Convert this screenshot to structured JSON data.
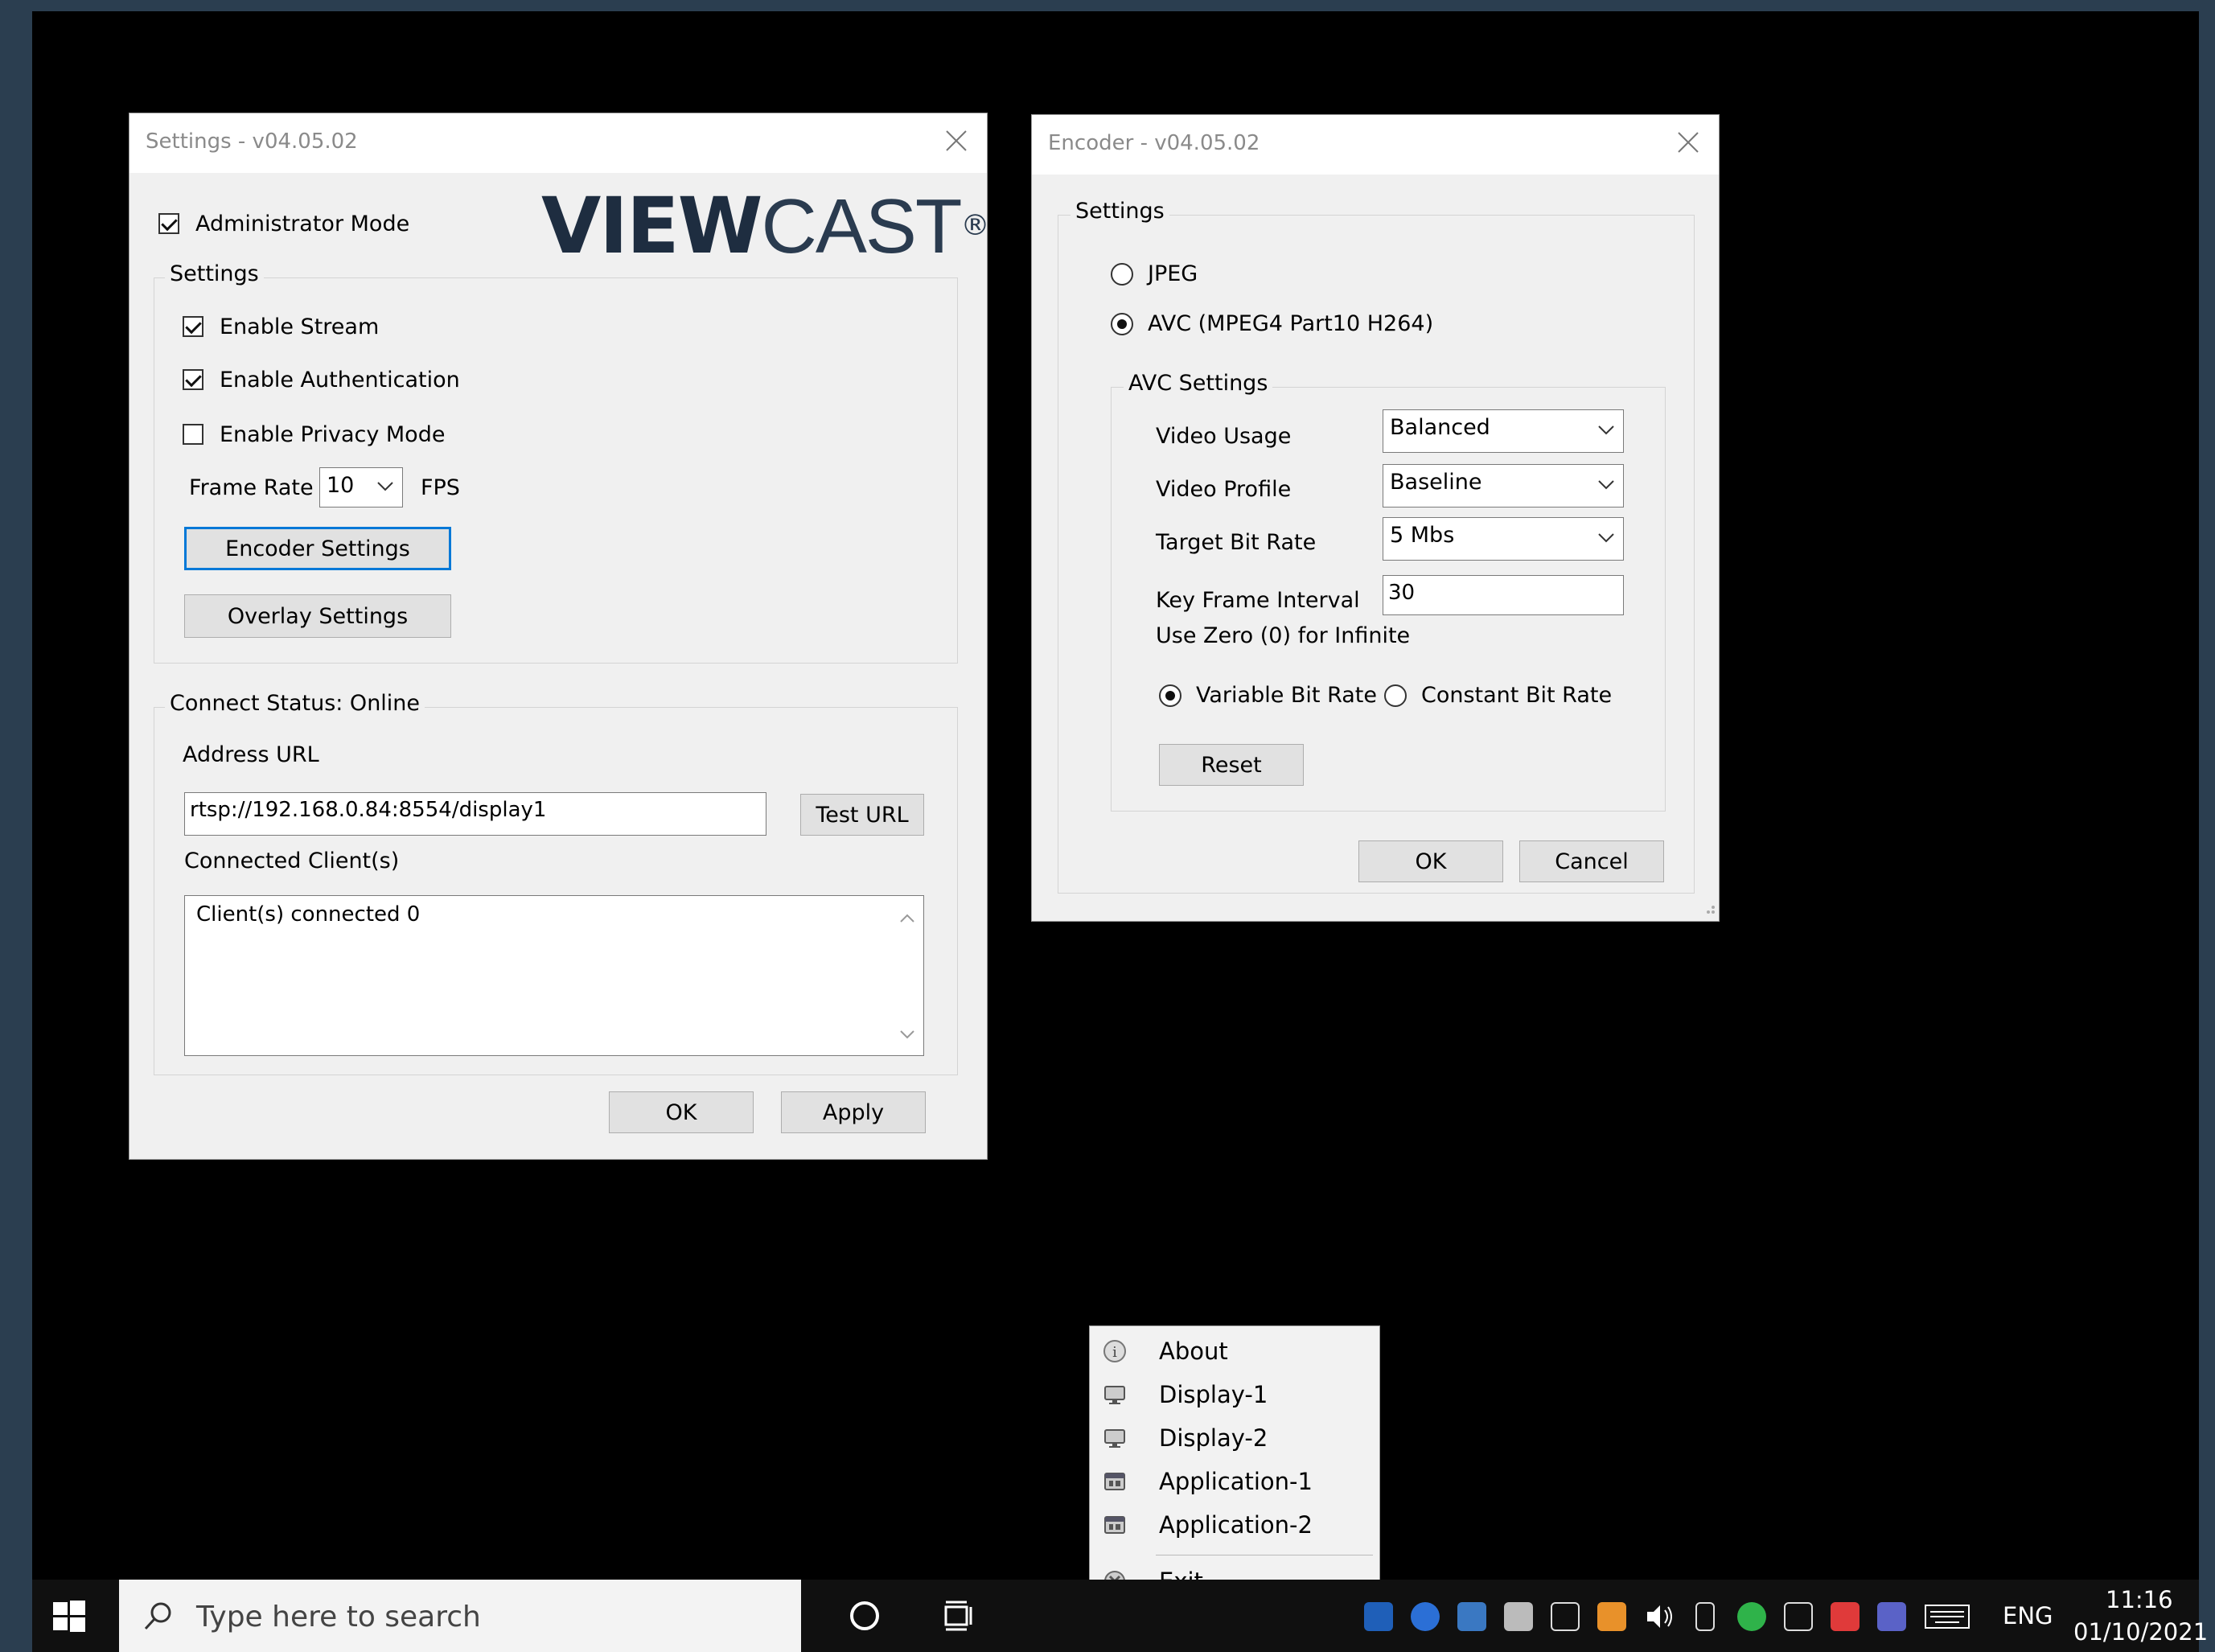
{
  "settings_window": {
    "title": "Settings - v04.05.02",
    "admin_mode_label": "Administrator Mode",
    "logo_bold": "VIEW",
    "logo_light": "CAST",
    "logo_mark": "®",
    "group_settings_label": "Settings",
    "enable_stream_label": "Enable Stream",
    "enable_auth_label": "Enable Authentication",
    "enable_privacy_label": "Enable Privacy Mode",
    "frame_rate_label": "Frame Rate",
    "frame_rate_value": "10",
    "fps_label": "FPS",
    "encoder_settings_label": "Encoder Settings",
    "overlay_settings_label": "Overlay Settings",
    "connect_status_label": "Connect Status: Online",
    "address_url_label": "Address URL",
    "address_url_value": "rtsp://192.168.0.84:8554/display1",
    "test_url_label": "Test URL",
    "connected_clients_label": "Connected Client(s)",
    "clients_text": "Client(s) connected 0",
    "ok_label": "OK",
    "apply_label": "Apply"
  },
  "encoder_window": {
    "title": "Encoder - v04.05.02",
    "group_settings_label": "Settings",
    "jpeg_label": "JPEG",
    "avc_label": "AVC (MPEG4 Part10 H264)",
    "avc_settings_label": "AVC Settings",
    "video_usage_label": "Video Usage",
    "video_usage_value": "Balanced",
    "video_profile_label": "Video Profile",
    "video_profile_value": "Baseline",
    "target_bitrate_label": "Target Bit Rate",
    "target_bitrate_value": "5 Mbs",
    "key_frame_label": "Key Frame Interval",
    "key_frame_hint": "Use Zero (0) for Infinite",
    "key_frame_value": "30",
    "vbr_label": "Variable Bit Rate",
    "cbr_label": "Constant Bit Rate",
    "reset_label": "Reset",
    "ok_label": "OK",
    "cancel_label": "Cancel"
  },
  "context_menu": {
    "items": [
      {
        "label": "About",
        "icon": "info-icon"
      },
      {
        "label": "Display-1",
        "icon": "monitor-icon"
      },
      {
        "label": "Display-2",
        "icon": "monitor-icon"
      },
      {
        "label": "Application-1",
        "icon": "application-icon"
      },
      {
        "label": "Application-2",
        "icon": "application-icon"
      },
      {
        "label": "Exit",
        "icon": "exit-icon"
      }
    ]
  },
  "taskbar": {
    "search_placeholder": "Type here to search",
    "language": "ENG",
    "time": "11:16",
    "date": "01/10/2021"
  },
  "colors": {
    "focus_blue": "#0078d7",
    "logo_dark": "#1e2d40",
    "logo_light": "#2a3b4f"
  }
}
